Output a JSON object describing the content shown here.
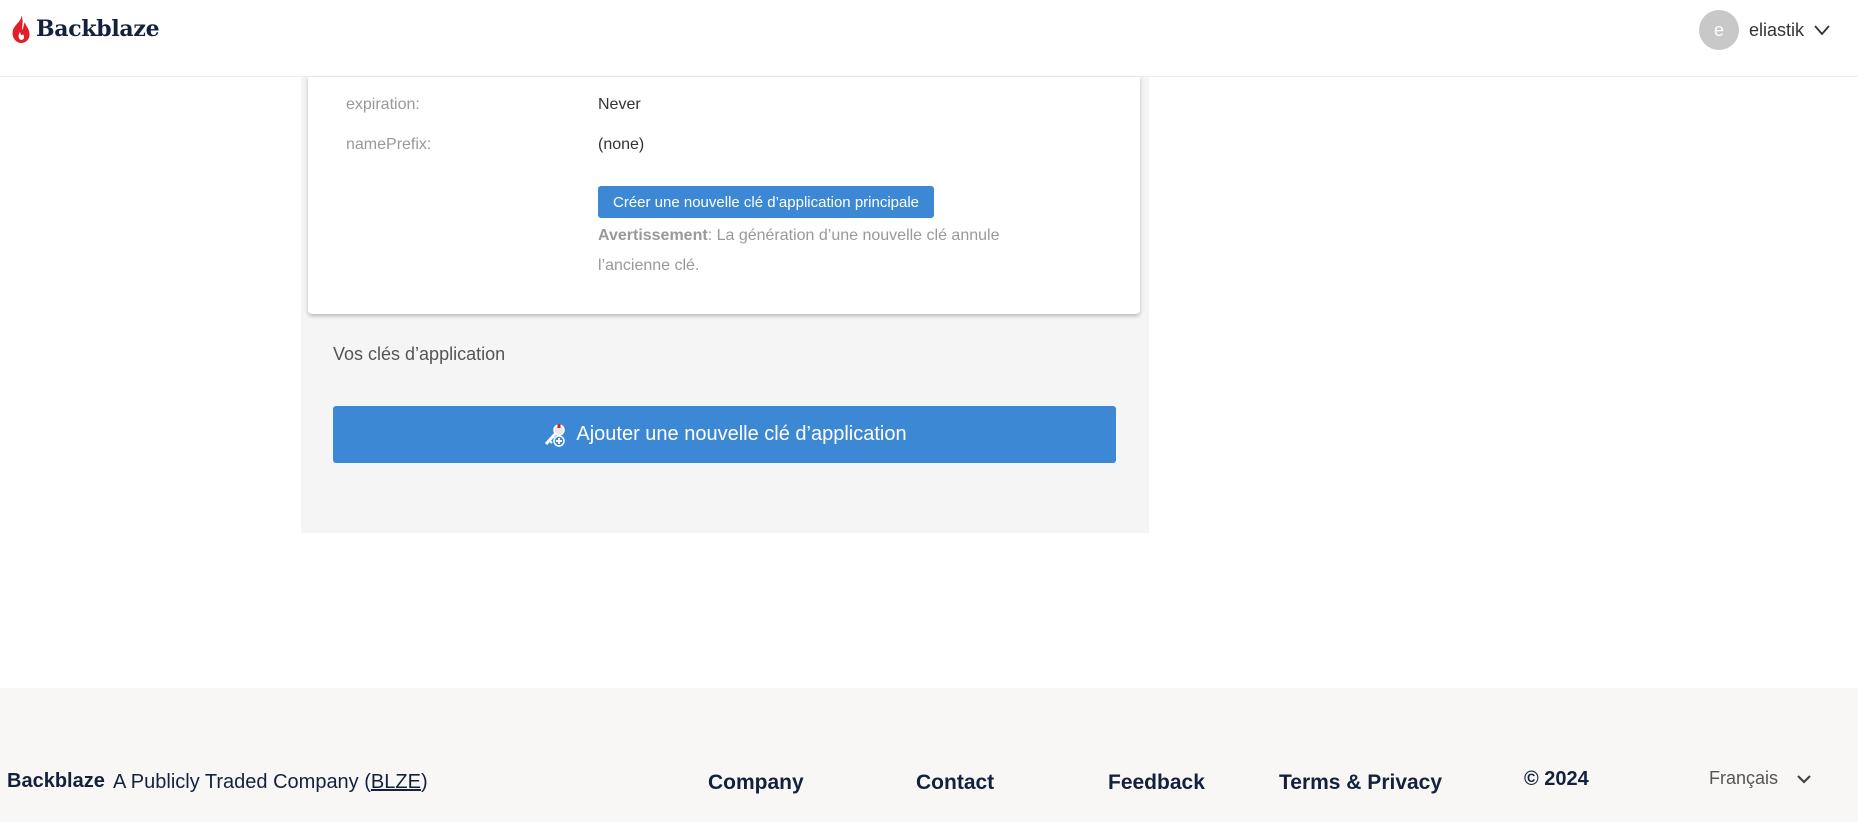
{
  "header": {
    "brand": "Backblaze",
    "user": {
      "avatar_letter": "e",
      "name": "eliastik"
    }
  },
  "key_card": {
    "rows": [
      {
        "label": "expiration:",
        "value": "Never"
      },
      {
        "label": "namePrefix:",
        "value": "(none)"
      }
    ],
    "create_master_key_button": "Créer une nouvelle clé d’application principale",
    "warning_title": "Avertissement",
    "warning_text": ": La génération d’une nouvelle clé annule l’ancienne clé."
  },
  "app_keys": {
    "section_title": "Vos clés d’application",
    "add_key_button": "Ajouter une nouvelle clé d’application"
  },
  "footer": {
    "brand": "Backblaze",
    "tagline_prefix": "A Publicly Traded Company (",
    "ticker": "BLZE",
    "tagline_suffix": ")",
    "links": [
      "Company",
      "Contact",
      "Feedback",
      "Terms & Privacy"
    ],
    "copyright": "© 2024",
    "language": "Français"
  },
  "colors": {
    "accent_blue": "#3d88d4",
    "brand_red": "#e21e29",
    "navy": "#14213d"
  }
}
